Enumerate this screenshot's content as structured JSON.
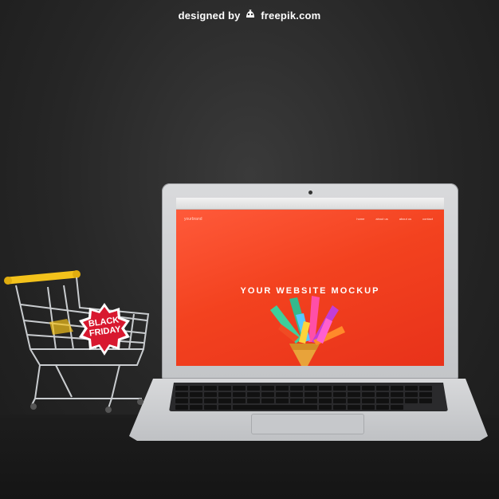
{
  "credit": {
    "prefix": "designed by",
    "brand": "freepik.com"
  },
  "laptop": {
    "website": {
      "brand": "yourbrand",
      "nav_items": [
        "home",
        "about us",
        "about us",
        "contact"
      ],
      "headline": "YOUR WEBSITE MOCKUP"
    }
  },
  "cart_badge": {
    "line1": "BLACK",
    "line2": "FRIDAY"
  },
  "colors": {
    "background": "#262626",
    "screen_red": "#f3421f",
    "cart_handle": "#f3c21b",
    "badge_red": "#d8182f"
  }
}
